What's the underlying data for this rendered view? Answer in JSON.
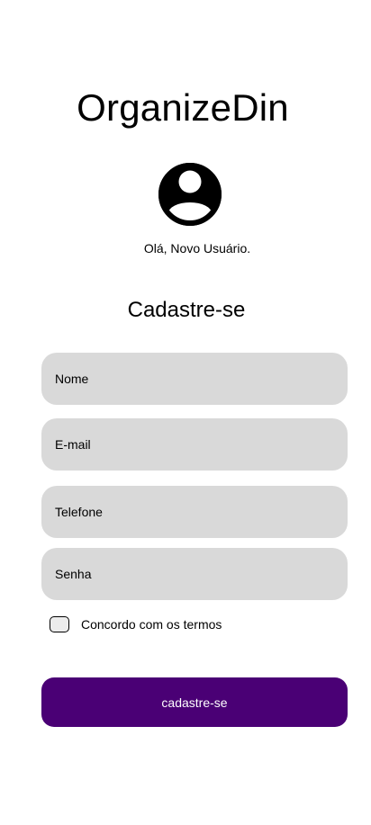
{
  "app": {
    "title": "OrganizeDin"
  },
  "profile": {
    "avatar_icon": "user-circle-icon",
    "greeting": "Olá, Novo Usuário."
  },
  "form": {
    "title": "Cadastre-se",
    "fields": [
      {
        "name": "nome",
        "placeholder": "Nome",
        "value": ""
      },
      {
        "name": "email",
        "placeholder": "E-mail",
        "value": ""
      },
      {
        "name": "telefone",
        "placeholder": "Telefone",
        "value": ""
      },
      {
        "name": "senha",
        "placeholder": "Senha",
        "value": ""
      }
    ],
    "terms": {
      "label": "Concordo com os termos",
      "checked": false
    },
    "submit_label": "cadastre-se"
  },
  "colors": {
    "field_background": "#d9d9d9",
    "primary_button": "#4a0075",
    "button_text": "#ffffff",
    "text": "#000000"
  }
}
